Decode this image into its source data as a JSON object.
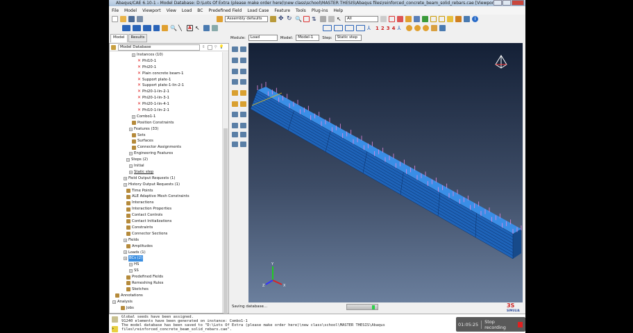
{
  "window": {
    "title": "Abaqus/CAE 6.10-1 - Model Database: D:\\Lots Of Extra (please make order here)\\new class\\school\\MASTER THESIS\\Abaqus files\\reinforced_concrete_beam_solid_rebars.cae [Viewport: 1]"
  },
  "menu": [
    "File",
    "Model",
    "Viewport",
    "View",
    "Load",
    "BC",
    "Predefined Field",
    "Load Case",
    "Feature",
    "Tools",
    "Plug-ins",
    "Help"
  ],
  "toolbar": {
    "render_style": "Assembly defaults",
    "selection_filter": "All",
    "csys_numbers": [
      "1",
      "2",
      "3",
      "4"
    ]
  },
  "tabs": [
    "Model",
    "Results"
  ],
  "context": {
    "module_label": "Module:",
    "module": "Load",
    "model_label": "Model:",
    "model": "Model-1",
    "step_label": "Step:",
    "step": "Static step"
  },
  "tree": {
    "root": "Model Database",
    "nodes": [
      {
        "label": "Instances (10)",
        "level": 1,
        "icon": "pm"
      },
      {
        "label": "Phi10-1",
        "level": 2,
        "icon": "x"
      },
      {
        "label": "Phi20-1",
        "level": 2,
        "icon": "x"
      },
      {
        "label": "Plain concrete beam-1",
        "level": 2,
        "icon": "x"
      },
      {
        "label": "Support plate-1",
        "level": 2,
        "icon": "x"
      },
      {
        "label": "Support plate-1-lin-2-1",
        "level": 2,
        "icon": "x"
      },
      {
        "label": "Phi20-1-lin-2-1",
        "level": 2,
        "icon": "x"
      },
      {
        "label": "Phi20-1-lin-3-1",
        "level": 2,
        "icon": "x"
      },
      {
        "label": "Phi20-1-lin-4-1",
        "level": 2,
        "icon": "x"
      },
      {
        "label": "Phi10-1-lin-2-1",
        "level": 2,
        "icon": "x"
      },
      {
        "label": "Combo1-1",
        "level": 1,
        "icon": "pm"
      },
      {
        "label": "Position Constraints",
        "level": 1,
        "icon": "t"
      },
      {
        "label": "Features (33)",
        "level": 0.5,
        "icon": "pm"
      },
      {
        "label": "Sets",
        "level": 1,
        "icon": "t"
      },
      {
        "label": "Surfaces",
        "level": 1,
        "icon": "t"
      },
      {
        "label": "Connector Assignments",
        "level": 1,
        "icon": "t"
      },
      {
        "label": "Engineering Features",
        "level": 0.5,
        "icon": "pm"
      },
      {
        "label": "Steps (2)",
        "level": 0,
        "icon": "pm"
      },
      {
        "label": "Initial",
        "level": 0.5,
        "icon": "pm"
      },
      {
        "label": "Static step",
        "level": 0.5,
        "icon": "pm",
        "underline": true
      },
      {
        "label": "Field Output Requests (1)",
        "level": -0.5,
        "icon": "pm"
      },
      {
        "label": "History Output Requests (1)",
        "level": -0.5,
        "icon": "pm"
      },
      {
        "label": "Time Points",
        "level": 0,
        "icon": "t"
      },
      {
        "label": "ALE Adaptive Mesh Constraints",
        "level": 0,
        "icon": "t"
      },
      {
        "label": "Interactions",
        "level": 0,
        "icon": "t"
      },
      {
        "label": "Interaction Properties",
        "level": 0,
        "icon": "t"
      },
      {
        "label": "Contact Controls",
        "level": 0,
        "icon": "t"
      },
      {
        "label": "Contact Initializations",
        "level": 0,
        "icon": "t"
      },
      {
        "label": "Constraints",
        "level": 0,
        "icon": "t"
      },
      {
        "label": "Connector Sections",
        "level": 0,
        "icon": "t"
      },
      {
        "label": "Fields",
        "level": -0.5,
        "icon": "pm"
      },
      {
        "label": "Amplitudes",
        "level": 0,
        "icon": "t"
      },
      {
        "label": "Loads (1)",
        "level": -0.5,
        "icon": "pm"
      },
      {
        "label": "BCs (2)",
        "level": -0.5,
        "icon": "pm",
        "selected": true
      },
      {
        "label": "HS",
        "level": 0.5,
        "icon": "pm"
      },
      {
        "label": "SS",
        "level": 0.5,
        "icon": "pm"
      },
      {
        "label": "Predefined Fields",
        "level": 0,
        "icon": "t"
      },
      {
        "label": "Remeshing Rules",
        "level": 0,
        "icon": "t"
      },
      {
        "label": "Sketches",
        "level": 0,
        "icon": "t"
      },
      {
        "label": "Annotations",
        "level": -2,
        "icon": "t"
      },
      {
        "label": "Analysis",
        "level": -2.5,
        "icon": "pm"
      },
      {
        "label": "Jobs",
        "level": -1,
        "icon": "t"
      }
    ]
  },
  "status": {
    "text": "Saving database...",
    "progress": 0.9
  },
  "messages": "Global seeds have been assigned.\n91240 elements have been generated on instance: Combo1-1\nThe model database has been saved to \"D:\\Lots Of Extra (please make order here)\\new class\\school\\MASTER THESIS\\Abaqus\nfiles\\reinforced_concrete_beam_solid_rebars.cae\".",
  "recording": {
    "time": "01:05:25",
    "stop_label": "Stop recording"
  },
  "brand": "SIMULIA",
  "colors": {
    "viewport_top": "#142036",
    "viewport_bottom": "#6b7f9d",
    "beam": "#2f7fd8",
    "selection": "#3b8ee0"
  }
}
